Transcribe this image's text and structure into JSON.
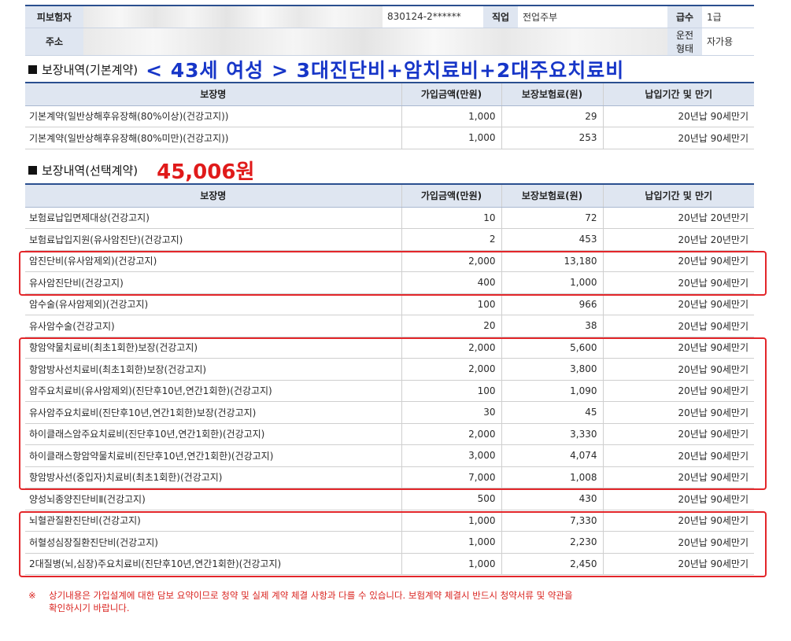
{
  "insured": {
    "name_label": "피보험자",
    "id_value": "830124-2******",
    "job_label": "직업",
    "job_value": "전업주부",
    "grade_label": "급수",
    "grade_value": "1급",
    "address_label": "주소",
    "drive_label": "운전형태",
    "drive_value": "자가용"
  },
  "basic": {
    "section_title": "보장내역(기본계약)",
    "highlight": "< 43세 여성 > 3대진단비+암치료비+2대주요치료비",
    "headers": [
      "보장명",
      "가입금액(만원)",
      "보장보험료(원)",
      "납입기간 및 만기"
    ],
    "rows": [
      {
        "name": "기본계약(일반상해후유장해(80%이상)(건강고지))",
        "amount": "1,000",
        "premium": "29",
        "term": "20년납 90세만기"
      },
      {
        "name": "기본계약(일반상해후유장해(80%미만)(건강고지))",
        "amount": "1,000",
        "premium": "253",
        "term": "20년납 90세만기"
      }
    ]
  },
  "optional": {
    "section_title": "보장내역(선택계약)",
    "total": "45,006원",
    "headers": [
      "보장명",
      "가입금액(만원)",
      "보장보험료(원)",
      "납입기간 및 만기"
    ],
    "rows": [
      {
        "name": "보험료납입면제대상(건강고지)",
        "amount": "10",
        "premium": "72",
        "term": "20년납 20년만기"
      },
      {
        "name": "보험료납입지원(유사암진단)(건강고지)",
        "amount": "2",
        "premium": "453",
        "term": "20년납 20년만기"
      },
      {
        "name": "암진단비(유사암제외)(건강고지)",
        "amount": "2,000",
        "premium": "13,180",
        "term": "20년납 90세만기"
      },
      {
        "name": "유사암진단비(건강고지)",
        "amount": "400",
        "premium": "1,000",
        "term": "20년납 90세만기"
      },
      {
        "name": "암수술(유사암제외)(건강고지)",
        "amount": "100",
        "premium": "966",
        "term": "20년납 90세만기"
      },
      {
        "name": "유사암수술(건강고지)",
        "amount": "20",
        "premium": "38",
        "term": "20년납 90세만기"
      },
      {
        "name": "항암약물치료비(최초1회한)보장(건강고지)",
        "amount": "2,000",
        "premium": "5,600",
        "term": "20년납 90세만기"
      },
      {
        "name": "항암방사선치료비(최초1회한)보장(건강고지)",
        "amount": "2,000",
        "premium": "3,800",
        "term": "20년납 90세만기"
      },
      {
        "name": "암주요치료비(유사암제외)(진단후10년,연간1회한)(건강고지)",
        "amount": "100",
        "premium": "1,090",
        "term": "20년납 90세만기"
      },
      {
        "name": "유사암주요치료비(진단후10년,연간1회한)보장(건강고지)",
        "amount": "30",
        "premium": "45",
        "term": "20년납 90세만기"
      },
      {
        "name": "하이클래스암주요치료비(진단후10년,연간1회한)(건강고지)",
        "amount": "2,000",
        "premium": "3,330",
        "term": "20년납 90세만기"
      },
      {
        "name": "하이클래스항암약물치료비(진단후10년,연간1회한)(건강고지)",
        "amount": "3,000",
        "premium": "4,074",
        "term": "20년납 90세만기"
      },
      {
        "name": "항암방사선(중입자)치료비(최초1회한)(건강고지)",
        "amount": "7,000",
        "premium": "1,008",
        "term": "20년납 90세만기"
      },
      {
        "name": "양성뇌종양진단비Ⅱ(건강고지)",
        "amount": "500",
        "premium": "430",
        "term": "20년납 90세만기"
      },
      {
        "name": "뇌혈관질환진단비(건강고지)",
        "amount": "1,000",
        "premium": "7,330",
        "term": "20년납 90세만기"
      },
      {
        "name": "허혈성심장질환진단비(건강고지)",
        "amount": "1,000",
        "premium": "2,230",
        "term": "20년납 90세만기"
      },
      {
        "name": "2대질병(뇌,심장)주요치료비(진단후10년,연간1회한)(건강고지)",
        "amount": "1,000",
        "premium": "2,450",
        "term": "20년납 90세만기"
      }
    ]
  },
  "note": {
    "mark": "※",
    "line1": "상기내용은 가입설계에 대한 담보 요약이므로 청약 및 실제 계약 체결 사항과 다를 수 있습니다. 보험계약 체결시 반드시 청약서류 및 약관을",
    "line2": "확인하시기 바랍니다."
  }
}
